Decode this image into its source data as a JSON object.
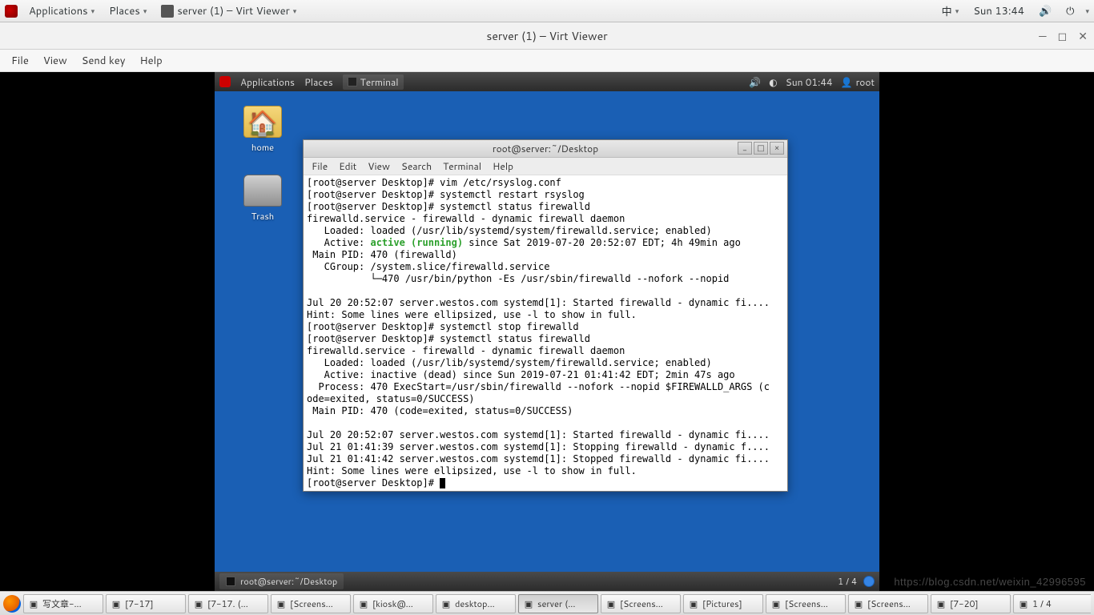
{
  "outer_panel": {
    "applications": "Applications",
    "places": "Places",
    "window_title_btn": "server (1) – Virt Viewer",
    "ime": "中",
    "clock": "Sun 13:44"
  },
  "vv": {
    "title": "server (1) – Virt Viewer",
    "menu": {
      "file": "File",
      "view": "View",
      "sendkey": "Send key",
      "help": "Help"
    }
  },
  "inner_panel": {
    "applications": "Applications",
    "places": "Places",
    "terminal": "Terminal",
    "clock": "Sun 01:44",
    "user": "root"
  },
  "desktop_icons": {
    "home": "home",
    "trash": "Trash"
  },
  "term": {
    "title": "root@server:~/Desktop",
    "menu": {
      "file": "File",
      "edit": "Edit",
      "view": "View",
      "search": "Search",
      "terminal": "Terminal",
      "help": "Help"
    },
    "lines_before": "[root@server Desktop]# vim /etc/rsyslog.conf\n[root@server Desktop]# systemctl restart rsyslog\n[root@server Desktop]# systemctl status firewalld\nfirewalld.service - firewalld - dynamic firewall daemon\n   Loaded: loaded (/usr/lib/systemd/system/firewalld.service; enabled)\n   Active: ",
    "active_status": "active (running)",
    "lines_after": " since Sat 2019-07-20 20:52:07 EDT; 4h 49min ago\n Main PID: 470 (firewalld)\n   CGroup: /system.slice/firewalld.service\n           └─470 /usr/bin/python -Es /usr/sbin/firewalld --nofork --nopid\n\nJul 20 20:52:07 server.westos.com systemd[1]: Started firewalld - dynamic fi....\nHint: Some lines were ellipsized, use -l to show in full.\n[root@server Desktop]# systemctl stop firewalld\n[root@server Desktop]# systemctl status firewalld\nfirewalld.service - firewalld - dynamic firewall daemon\n   Loaded: loaded (/usr/lib/systemd/system/firewalld.service; enabled)\n   Active: inactive (dead) since Sun 2019-07-21 01:41:42 EDT; 2min 47s ago\n  Process: 470 ExecStart=/usr/sbin/firewalld --nofork --nopid $FIREWALLD_ARGS (c\node=exited, status=0/SUCCESS)\n Main PID: 470 (code=exited, status=0/SUCCESS)\n\nJul 20 20:52:07 server.westos.com systemd[1]: Started firewalld - dynamic fi....\nJul 21 01:41:39 server.westos.com systemd[1]: Stopping firewalld - dynamic f....\nJul 21 01:41:42 server.westos.com systemd[1]: Stopped firewalld - dynamic fi....\nHint: Some lines were ellipsized, use -l to show in full.\n[root@server Desktop]# "
  },
  "inner_taskbar": {
    "task": "root@server:~/Desktop",
    "workspace": "1 / 4"
  },
  "outer_taskbar": {
    "items": [
      "写文章-...",
      "[7-17]",
      "[7-17. (...",
      "[Screens...",
      "[kiosk@...",
      "desktop...",
      "server (...",
      "[Screens...",
      "[Pictures]",
      "[Screens...",
      "[Screens...",
      "[7-20]",
      "1 / 4"
    ],
    "active_index": 6
  },
  "watermark": "https://blog.csdn.net/weixin_42996595"
}
